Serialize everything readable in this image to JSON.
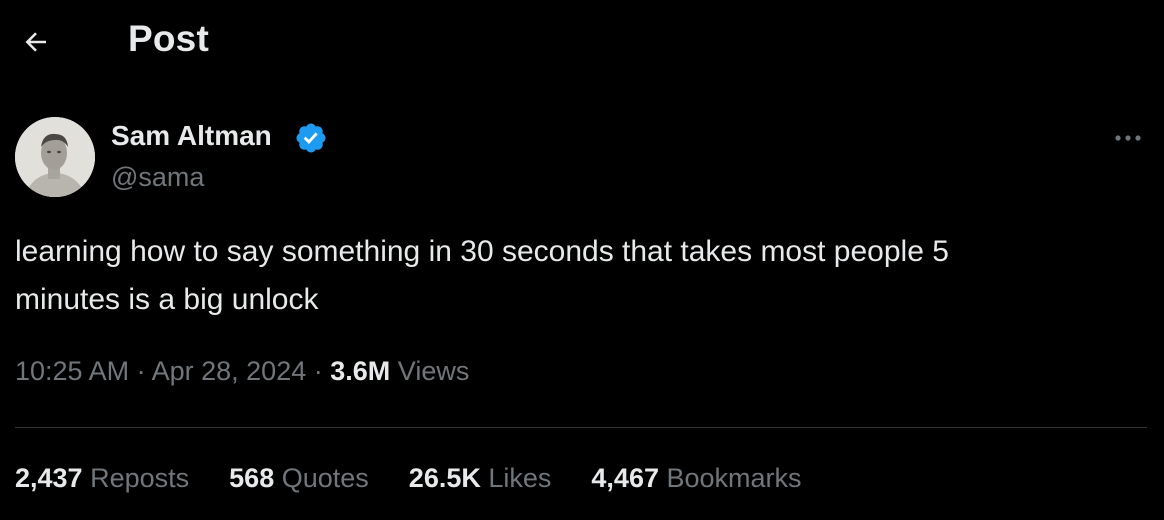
{
  "header": {
    "back_icon": "arrow-left-icon",
    "title": "Post"
  },
  "author": {
    "name": "Sam Altman",
    "handle": "@sama",
    "verified_icon": "verified-badge-icon",
    "verified_color": "#1d9bf0"
  },
  "more_icon": "more-horizontal-icon",
  "post": {
    "text": "learning how to say something in 30 seconds that takes most people 5\nminutes is a big unlock",
    "time": "10:25 AM",
    "date": "Apr 28, 2024",
    "views_count": "3.6M",
    "views_label": "Views"
  },
  "stats": [
    {
      "count": "2,437",
      "label": "Reposts"
    },
    {
      "count": "568",
      "label": "Quotes"
    },
    {
      "count": "26.5K",
      "label": "Likes"
    },
    {
      "count": "4,467",
      "label": "Bookmarks"
    }
  ],
  "colors": {
    "background": "#000000",
    "text_primary": "#e7e9ea",
    "text_secondary": "#71767b",
    "divider": "#2f3336"
  }
}
